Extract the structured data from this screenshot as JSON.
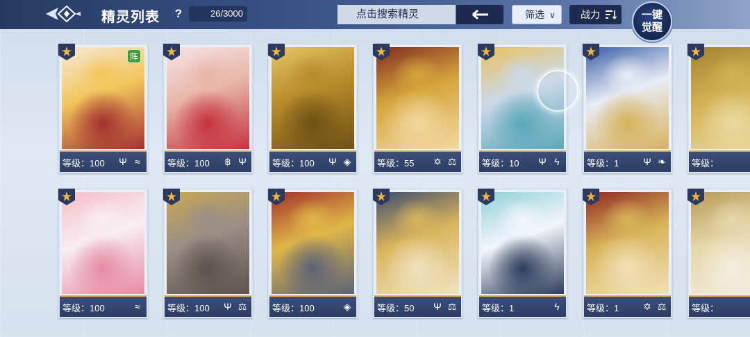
{
  "header": {
    "title": "精灵列表",
    "help_label": "?",
    "count": "26/3000",
    "search_placeholder": "点击搜索精灵",
    "filter_label": "筛选",
    "power_label": "战力",
    "awaken_line1": "一键",
    "awaken_line2": "觉醒"
  },
  "cards": [
    {
      "level": "等级：100",
      "icons": [
        "trident-icon",
        "wave-icon"
      ],
      "formation": "阵",
      "art": [
        "#f3c65c",
        "#f5e8d8",
        "#a2312f"
      ]
    },
    {
      "level": "等级：100",
      "icons": [
        "swirl-icon",
        "trident-icon"
      ],
      "art": [
        "#e8b6a8",
        "#f7e4e8",
        "#c5323f"
      ]
    },
    {
      "level": "等级：100",
      "icons": [
        "trident-icon",
        "shield-icon"
      ],
      "art": [
        "#b88a2a",
        "#e5c566",
        "#6d5215"
      ]
    },
    {
      "level": "等级：55",
      "icons": [
        "star-icon",
        "scale-icon"
      ],
      "art": [
        "#d6a53b",
        "#7f2b22",
        "#f2d9a2"
      ]
    },
    {
      "level": "等级：10",
      "icons": [
        "trident-icon",
        "lightning-icon"
      ],
      "art": [
        "#cbd9e9",
        "#e9c15d",
        "#5aa7b8"
      ]
    },
    {
      "level": "等级：1",
      "icons": [
        "trident-icon",
        "wing-icon"
      ],
      "art": [
        "#e8ecf5",
        "#3a5ea8",
        "#d7b25b"
      ]
    },
    {
      "level": "等级：",
      "icons": [],
      "art": [
        "#d3b254",
        "#a28230",
        "#ebd9a0"
      ]
    },
    {
      "level": "等级：100",
      "icons": [
        "wave-icon"
      ],
      "art": [
        "#f9eef3",
        "#f5bcc8",
        "#e68aa5"
      ]
    },
    {
      "level": "等级：100",
      "icons": [
        "trident-icon",
        "scale-icon"
      ],
      "art": [
        "#9a8e86",
        "#c9a853",
        "#5d524d"
      ]
    },
    {
      "level": "等级：100",
      "icons": [
        "shield-icon"
      ],
      "art": [
        "#e0b748",
        "#a23029",
        "#5b6278"
      ]
    },
    {
      "level": "等级：50",
      "icons": [
        "trident-icon",
        "scale-icon"
      ],
      "art": [
        "#d9b45c",
        "#3d4d6e",
        "#f0e2c0"
      ]
    },
    {
      "level": "等级：1",
      "icons": [
        "lightning-icon"
      ],
      "art": [
        "#f3f6fb",
        "#8fd0d8",
        "#2c3d5d"
      ]
    },
    {
      "level": "等级：1",
      "icons": [
        "star-icon",
        "scale-icon"
      ],
      "art": [
        "#d8b45a",
        "#8e2720",
        "#f1e0b8"
      ]
    },
    {
      "level": "等级：",
      "icons": [],
      "art": [
        "#e7d7ac",
        "#b69b55",
        "#f3eee0"
      ]
    }
  ],
  "colors": {
    "accent_gold": "#c7a552",
    "bar_navy": "#2d3d63",
    "header_navy": "#263a63"
  }
}
